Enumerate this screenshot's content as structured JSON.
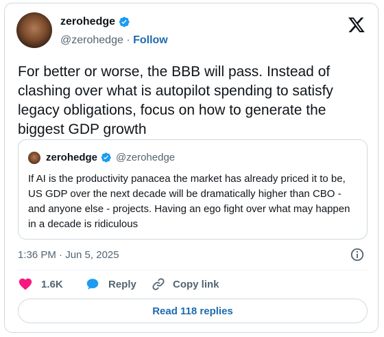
{
  "author": {
    "name": "zerohedge",
    "handle": "@zerohedge",
    "separator": "·",
    "follow_label": "Follow"
  },
  "icons": {
    "verified": "verified-badge-icon",
    "x_logo": "x-logo-icon",
    "info": "info-icon",
    "like": "heart-icon",
    "reply": "speech-bubble-icon",
    "copy": "link-icon"
  },
  "tweet": {
    "text": "For better or worse, the BBB will pass. Instead of clashing over what is autopilot spending to satisfy legacy obligations, focus on how to generate the biggest GDP growth"
  },
  "quote": {
    "name": "zerohedge",
    "handle": "@zerohedge",
    "text": "If AI is the productivity panacea the market has already priced it to be, US GDP over the next decade will be dramatically higher than CBO - and anyone else - projects. Having an ego fight over what may happen in a decade is ridiculous"
  },
  "meta": {
    "timestamp": "1:36 PM · Jun 5, 2025"
  },
  "actions": {
    "like_count": "1.6K",
    "reply_label": "Reply",
    "copy_label": "Copy link"
  },
  "replies": {
    "label": "Read 118 replies"
  },
  "colors": {
    "link": "#1d6bb0",
    "verified": "#1d9bf0",
    "heart": "#f91880",
    "muted": "#536471",
    "border": "#cfd9de"
  }
}
